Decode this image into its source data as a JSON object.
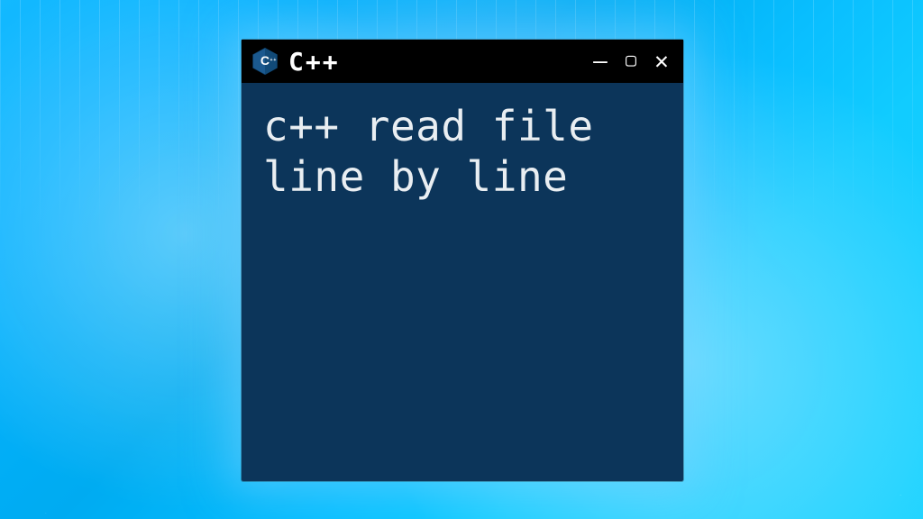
{
  "window": {
    "title": "C++",
    "logo_letter": "C",
    "controls": {
      "minimize_glyph": "—",
      "maximize_glyph": "▢",
      "close_glyph": "✕"
    }
  },
  "content": {
    "text": "c++ read file line by line"
  },
  "colors": {
    "titlebar_bg": "#000000",
    "window_bg": "#0c355a",
    "text": "#e9eef2"
  }
}
